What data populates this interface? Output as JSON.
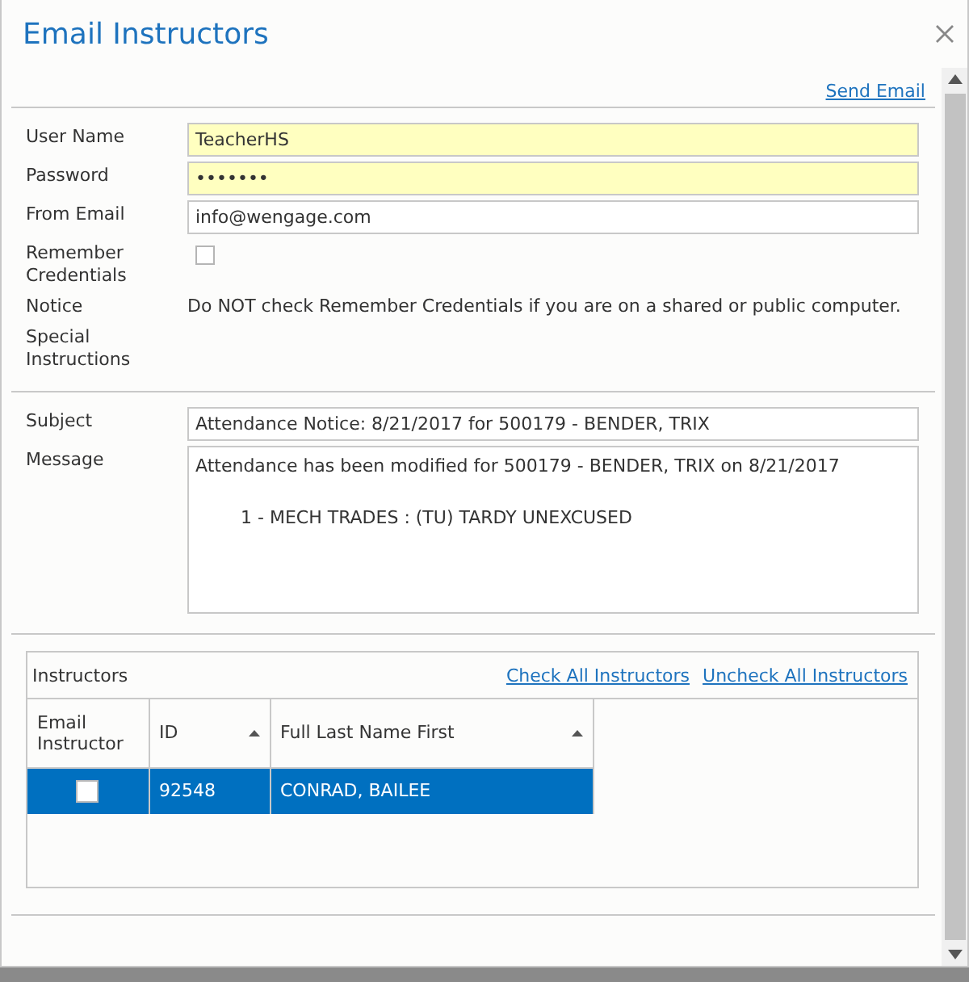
{
  "window": {
    "title": "Email Instructors"
  },
  "send_link": "Send Email",
  "credentials": [
    {
      "label": "User Name",
      "kind": "input",
      "value": "TeacherHS",
      "highlighted": true
    },
    {
      "label": "Password",
      "kind": "input",
      "value": "•••••••",
      "highlighted": true
    },
    {
      "label": "From Email",
      "kind": "input",
      "value": "info@wengage.com",
      "highlighted": false
    },
    {
      "label": "Remember Credentials",
      "kind": "checkbox",
      "checked": false
    },
    {
      "label": "Notice",
      "kind": "text",
      "value": "Do NOT check Remember Credentials if you are on a shared or public computer."
    },
    {
      "label": "Special Instructions",
      "kind": "text"
    }
  ],
  "subject": {
    "label": "Subject",
    "value": "Attendance Notice: 8/21/2017 for 500179 - BENDER, TRIX"
  },
  "message": {
    "label": "Message",
    "lines": [
      "Attendance has been modified for 500179 - BENDER, TRIX on 8/21/2017",
      "1 - MECH TRADES : (TU) TARDY UNEXCUSED"
    ]
  },
  "instructors": {
    "title": "Instructors",
    "links": [
      "Check All Instructors",
      "Uncheck All Instructors"
    ],
    "columns": [
      {
        "label": "Email Instructor",
        "sortable": false
      },
      {
        "label": "ID",
        "sortable": true
      },
      {
        "label": "Full Last Name First",
        "sortable": true
      }
    ],
    "rows": [
      {
        "checked": false,
        "selected": true,
        "id": "92548",
        "name": "CONRAD, BAILEE"
      }
    ]
  }
}
